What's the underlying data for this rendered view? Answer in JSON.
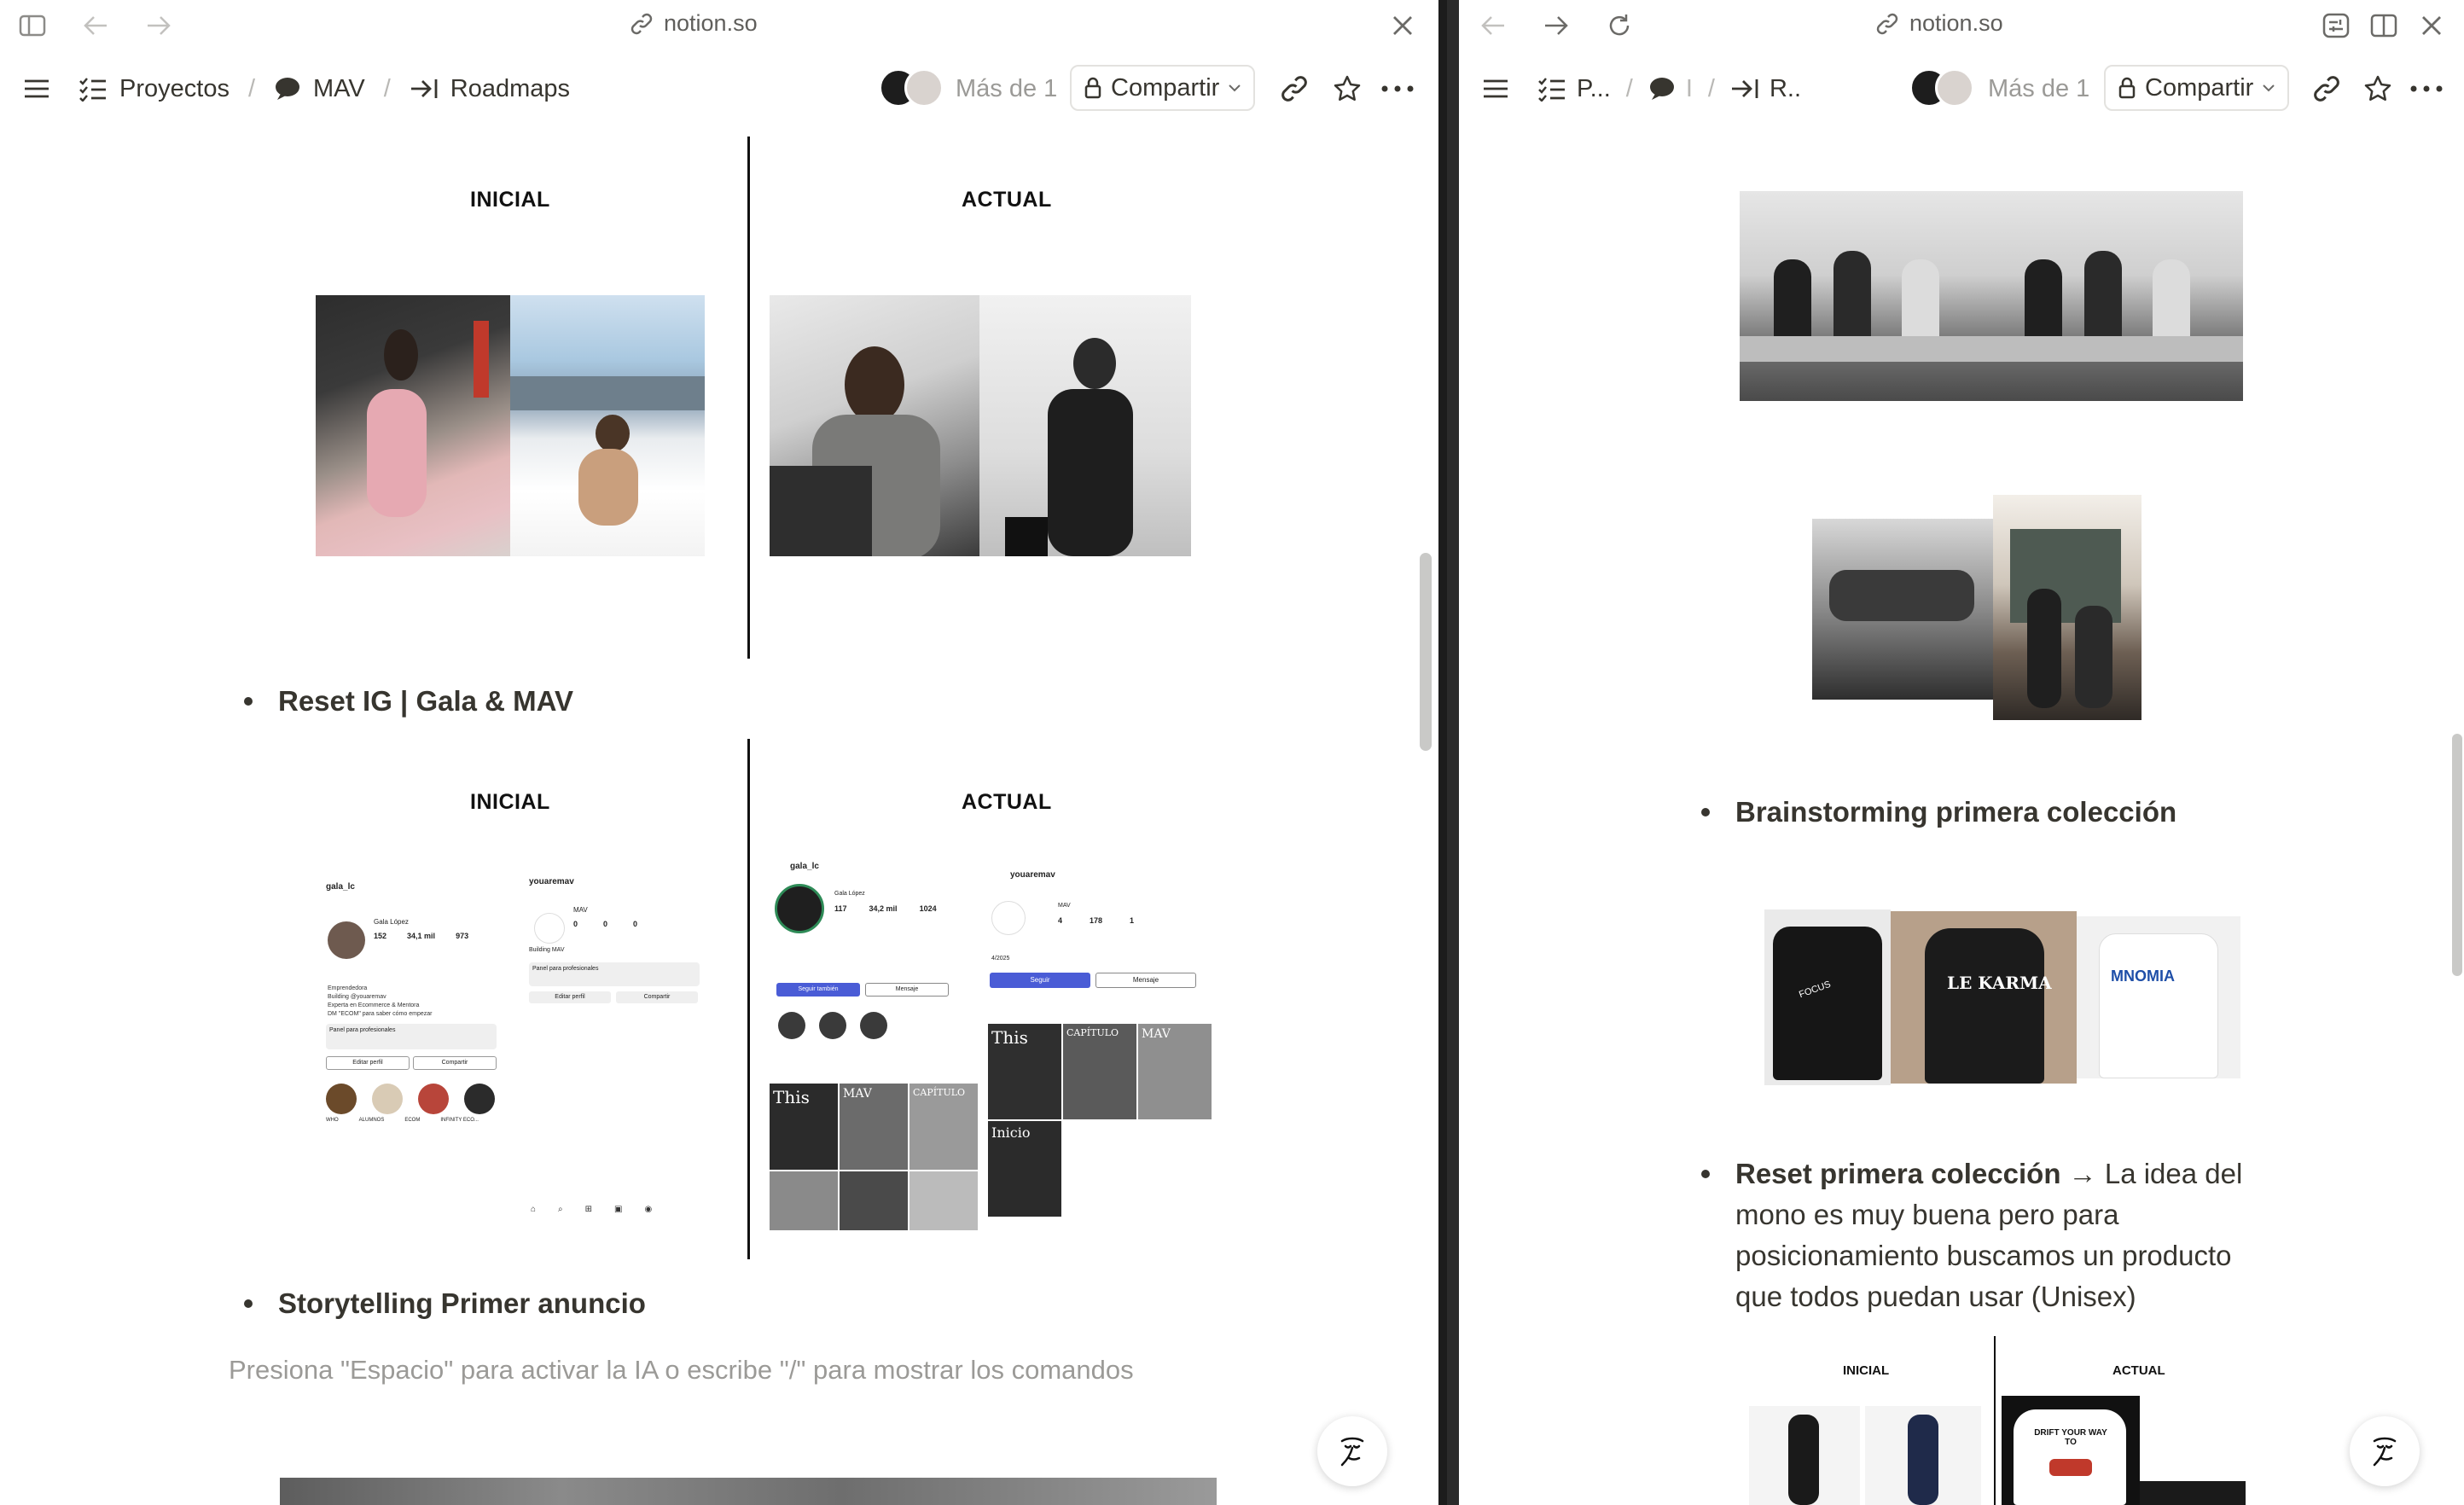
{
  "left": {
    "chrome": {
      "url": "notion.so"
    },
    "breadcrumb": [
      {
        "label": "Proyectos",
        "icon": "checklist-icon"
      },
      {
        "label": "MAV",
        "icon": "speech-bubble-icon"
      },
      {
        "label": "Roadmaps",
        "icon": "arrow-to-line-icon"
      }
    ],
    "viewers": "Más de 1",
    "share_label": "Compartir",
    "sections": {
      "inicial_1": "INICIAL",
      "actual_1": "ACTUAL",
      "bullet_reset_ig": "Reset IG | Gala & MAV",
      "inicial_2": "INICIAL",
      "actual_2": "ACTUAL",
      "bullet_storytelling": "Storytelling Primer anuncio"
    },
    "placeholder": "Presiona \"Espacio\" para activar la IA o escribe \"/\" para mostrar los comandos",
    "ig_profiles": {
      "a": {
        "handle": "gala_lc",
        "posts": "152",
        "followers": "34,1 mil",
        "following": "973",
        "name": "Gala López",
        "bio1": "Emprendedora",
        "bio2": "Building @youaremav",
        "bio3": "Experta en Ecommerce & Mentora",
        "bio4": "DM \"ECOM\" para saber cómo empezar",
        "panel": "Panel para profesionales",
        "edit": "Editar perfil",
        "share": "Compartir",
        "h1": "WHO",
        "h2": "ALUMNOS",
        "h3": "ECOM",
        "h4": "INFINITY ECO..."
      },
      "b": {
        "handle": "youaremav",
        "posts": "0",
        "followers": "0",
        "following": "0",
        "name": "MAV",
        "bio1": "Building MAV",
        "panel": "Panel para profesionales",
        "edit": "Editar perfil",
        "share": "Compartir"
      },
      "c": {
        "handle": "gala_lc",
        "posts": "117",
        "followers": "34,2 mil",
        "following": "1024",
        "name": "Gala López",
        "follow": "Seguir también",
        "message": "Mensaje",
        "t1": "This",
        "t2": "MAV",
        "t3": "CAPÍTULO"
      },
      "d": {
        "handle": "youaremav",
        "posts": "4",
        "followers": "178",
        "following": "1",
        "name": "MAV",
        "date": "4/2025",
        "follow": "Seguir",
        "message": "Mensaje",
        "t1": "This",
        "t2": "CAPÍTULO",
        "t3": "MAV",
        "t4": "Inicio"
      }
    }
  },
  "right": {
    "chrome": {
      "url": "notion.so"
    },
    "breadcrumb": [
      {
        "label": "P...",
        "icon": "checklist-icon"
      },
      {
        "label": "I",
        "icon": "speech-bubble-icon"
      },
      {
        "label": "R..",
        "icon": "arrow-to-line-icon"
      }
    ],
    "viewers": "Más de 1",
    "share_label": "Compartir",
    "bullet_brainstorming": "Brainstorming primera colección",
    "bullet_reset_bold": "Reset primera colección",
    "bullet_reset_rest": " → La idea del mono es muy buena pero para posicionamiento buscamos un producto que todos puedan usar (Unisex)",
    "inicial": "INICIAL",
    "actual": "ACTUAL",
    "shirt_texts": {
      "s1": "FOCUS",
      "s2": "LE KARMA",
      "s3": "MNOMIA",
      "poster": "DRIFT YOUR WAY TO"
    }
  },
  "colors": {
    "accent": "#5b51d8",
    "text": "#37352f",
    "muted": "#9b9a97"
  }
}
